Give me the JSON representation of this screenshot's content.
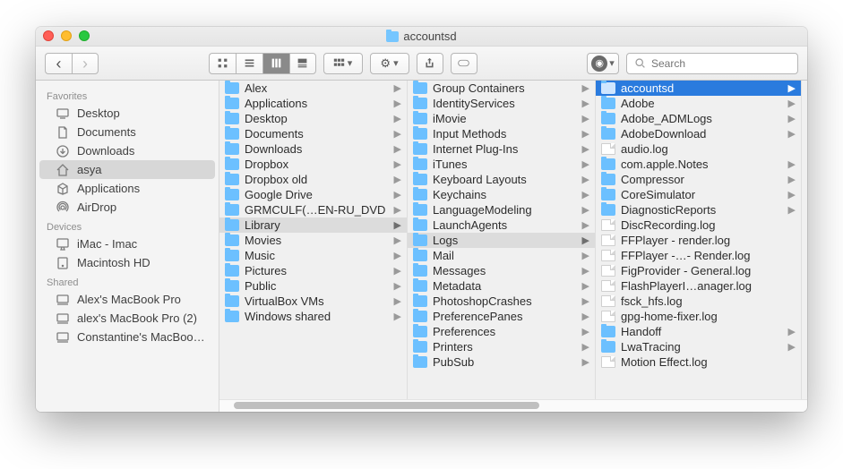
{
  "window": {
    "title": "accountsd"
  },
  "search": {
    "placeholder": "Search"
  },
  "sidebar": {
    "sections": [
      {
        "label": "Favorites",
        "items": [
          {
            "label": "Desktop",
            "icon": "desktop-icon"
          },
          {
            "label": "Documents",
            "icon": "documents-icon"
          },
          {
            "label": "Downloads",
            "icon": "downloads-icon"
          },
          {
            "label": "asya",
            "icon": "home-icon",
            "selected": true
          },
          {
            "label": "Applications",
            "icon": "applications-icon"
          },
          {
            "label": "AirDrop",
            "icon": "airdrop-icon"
          }
        ]
      },
      {
        "label": "Devices",
        "items": [
          {
            "label": "iMac - Imac",
            "icon": "imac-icon"
          },
          {
            "label": "Macintosh HD",
            "icon": "disk-icon"
          }
        ]
      },
      {
        "label": "Shared",
        "items": [
          {
            "label": "Alex's MacBook Pro",
            "icon": "shared-computer-icon"
          },
          {
            "label": "alex's MacBook Pro (2)",
            "icon": "shared-computer-icon"
          },
          {
            "label": "Constantine's MacBoo…",
            "icon": "shared-computer-icon"
          }
        ]
      }
    ]
  },
  "columns": [
    {
      "selected_index": 9,
      "selection_style": "gray",
      "items": [
        {
          "name": "Alex",
          "type": "folder",
          "has_children": true
        },
        {
          "name": "Applications",
          "type": "folder",
          "has_children": true
        },
        {
          "name": "Desktop",
          "type": "folder",
          "has_children": true
        },
        {
          "name": "Documents",
          "type": "folder",
          "has_children": true
        },
        {
          "name": "Downloads",
          "type": "folder",
          "has_children": true
        },
        {
          "name": "Dropbox",
          "type": "folder",
          "has_children": true
        },
        {
          "name": "Dropbox old",
          "type": "folder",
          "has_children": true
        },
        {
          "name": "Google Drive",
          "type": "folder",
          "has_children": true
        },
        {
          "name": "GRMCULF(…EN-RU_DVD",
          "type": "folder",
          "has_children": true
        },
        {
          "name": "Library",
          "type": "folder",
          "has_children": true
        },
        {
          "name": "Movies",
          "type": "folder",
          "has_children": true
        },
        {
          "name": "Music",
          "type": "folder",
          "has_children": true
        },
        {
          "name": "Pictures",
          "type": "folder",
          "has_children": true
        },
        {
          "name": "Public",
          "type": "folder",
          "has_children": true
        },
        {
          "name": "VirtualBox VMs",
          "type": "folder",
          "has_children": true
        },
        {
          "name": "Windows shared",
          "type": "folder",
          "has_children": true
        }
      ]
    },
    {
      "selected_index": 10,
      "selection_style": "gray",
      "items": [
        {
          "name": "Group Containers",
          "type": "folder",
          "has_children": true
        },
        {
          "name": "IdentityServices",
          "type": "folder",
          "has_children": true
        },
        {
          "name": "iMovie",
          "type": "folder",
          "has_children": true
        },
        {
          "name": "Input Methods",
          "type": "folder",
          "has_children": true
        },
        {
          "name": "Internet Plug-Ins",
          "type": "folder",
          "has_children": true
        },
        {
          "name": "iTunes",
          "type": "folder",
          "has_children": true
        },
        {
          "name": "Keyboard Layouts",
          "type": "folder",
          "has_children": true
        },
        {
          "name": "Keychains",
          "type": "folder",
          "has_children": true
        },
        {
          "name": "LanguageModeling",
          "type": "folder",
          "has_children": true
        },
        {
          "name": "LaunchAgents",
          "type": "folder",
          "has_children": true
        },
        {
          "name": "Logs",
          "type": "folder",
          "has_children": true
        },
        {
          "name": "Mail",
          "type": "folder",
          "has_children": true
        },
        {
          "name": "Messages",
          "type": "folder",
          "has_children": true
        },
        {
          "name": "Metadata",
          "type": "folder",
          "has_children": true
        },
        {
          "name": "PhotoshopCrashes",
          "type": "folder",
          "has_children": true
        },
        {
          "name": "PreferencePanes",
          "type": "folder",
          "has_children": true
        },
        {
          "name": "Preferences",
          "type": "folder",
          "has_children": true
        },
        {
          "name": "Printers",
          "type": "folder",
          "has_children": true
        },
        {
          "name": "PubSub",
          "type": "folder",
          "has_children": true
        }
      ]
    },
    {
      "selected_index": 0,
      "selection_style": "blue",
      "items": [
        {
          "name": "accountsd",
          "type": "folder",
          "has_children": true
        },
        {
          "name": "Adobe",
          "type": "folder",
          "has_children": true
        },
        {
          "name": "Adobe_ADMLogs",
          "type": "folder",
          "has_children": true
        },
        {
          "name": "AdobeDownload",
          "type": "folder",
          "has_children": true
        },
        {
          "name": "audio.log",
          "type": "file",
          "has_children": false
        },
        {
          "name": "com.apple.Notes",
          "type": "folder",
          "has_children": true
        },
        {
          "name": "Compressor",
          "type": "folder",
          "has_children": true
        },
        {
          "name": "CoreSimulator",
          "type": "folder",
          "has_children": true
        },
        {
          "name": "DiagnosticReports",
          "type": "folder",
          "has_children": true
        },
        {
          "name": "DiscRecording.log",
          "type": "file",
          "has_children": false
        },
        {
          "name": "FFPlayer - render.log",
          "type": "file",
          "has_children": false
        },
        {
          "name": "FFPlayer -…- Render.log",
          "type": "file",
          "has_children": false
        },
        {
          "name": "FigProvider - General.log",
          "type": "file",
          "has_children": false
        },
        {
          "name": "FlashPlayerI…anager.log",
          "type": "file",
          "has_children": false
        },
        {
          "name": "fsck_hfs.log",
          "type": "file",
          "has_children": false
        },
        {
          "name": "gpg-home-fixer.log",
          "type": "file",
          "has_children": false
        },
        {
          "name": "Handoff",
          "type": "folder",
          "has_children": true
        },
        {
          "name": "LwaTracing",
          "type": "folder",
          "has_children": true
        },
        {
          "name": "Motion Effect.log",
          "type": "file",
          "has_children": false
        }
      ]
    }
  ]
}
